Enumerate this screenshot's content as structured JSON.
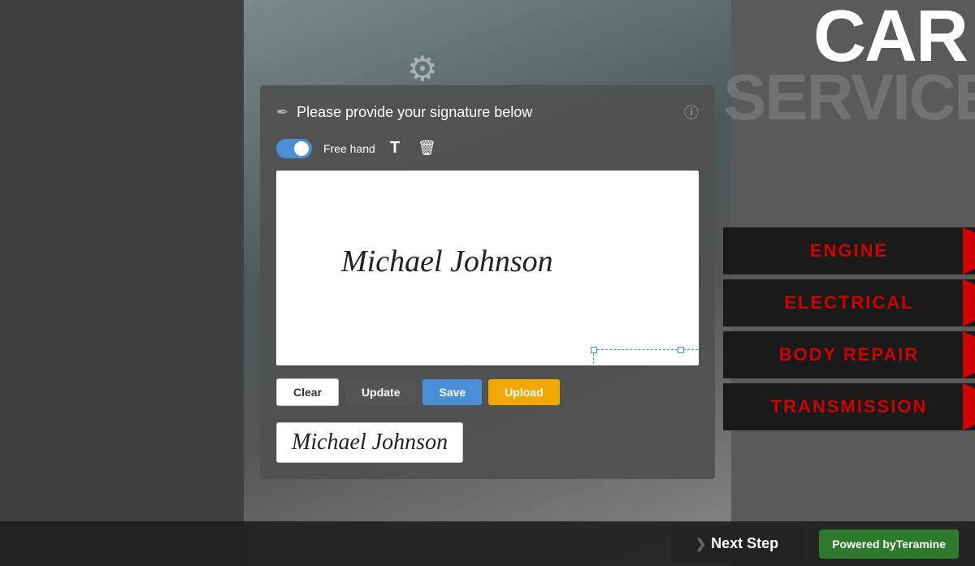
{
  "background": {
    "color": "#5a5a5a"
  },
  "modal": {
    "title": "Please provide your signature below",
    "title_icon": "✒",
    "info_icon": "ⓘ",
    "toolbar": {
      "toggle_label": "Free hand",
      "text_icon": "T",
      "trash_icon": "🗑"
    },
    "signature_text": "Michael Johnson",
    "buttons": {
      "clear": "Clear",
      "update": "Update",
      "save": "Save",
      "upload": "Upload"
    },
    "preview_text": "Michael Johnson"
  },
  "right_panel": {
    "title_line1": "CAR",
    "title_line2": "SERVICE",
    "menu_items": [
      {
        "label": "ENGINE"
      },
      {
        "label": "ELECTRICAL"
      },
      {
        "label": "BODY REPAIR"
      },
      {
        "label": "TRANSMISSION"
      }
    ]
  },
  "footer": {
    "next_step_label": "Next Step",
    "next_step_arrow": "❯",
    "powered_by_text": "Powered by",
    "brand_name": "Teramine"
  }
}
